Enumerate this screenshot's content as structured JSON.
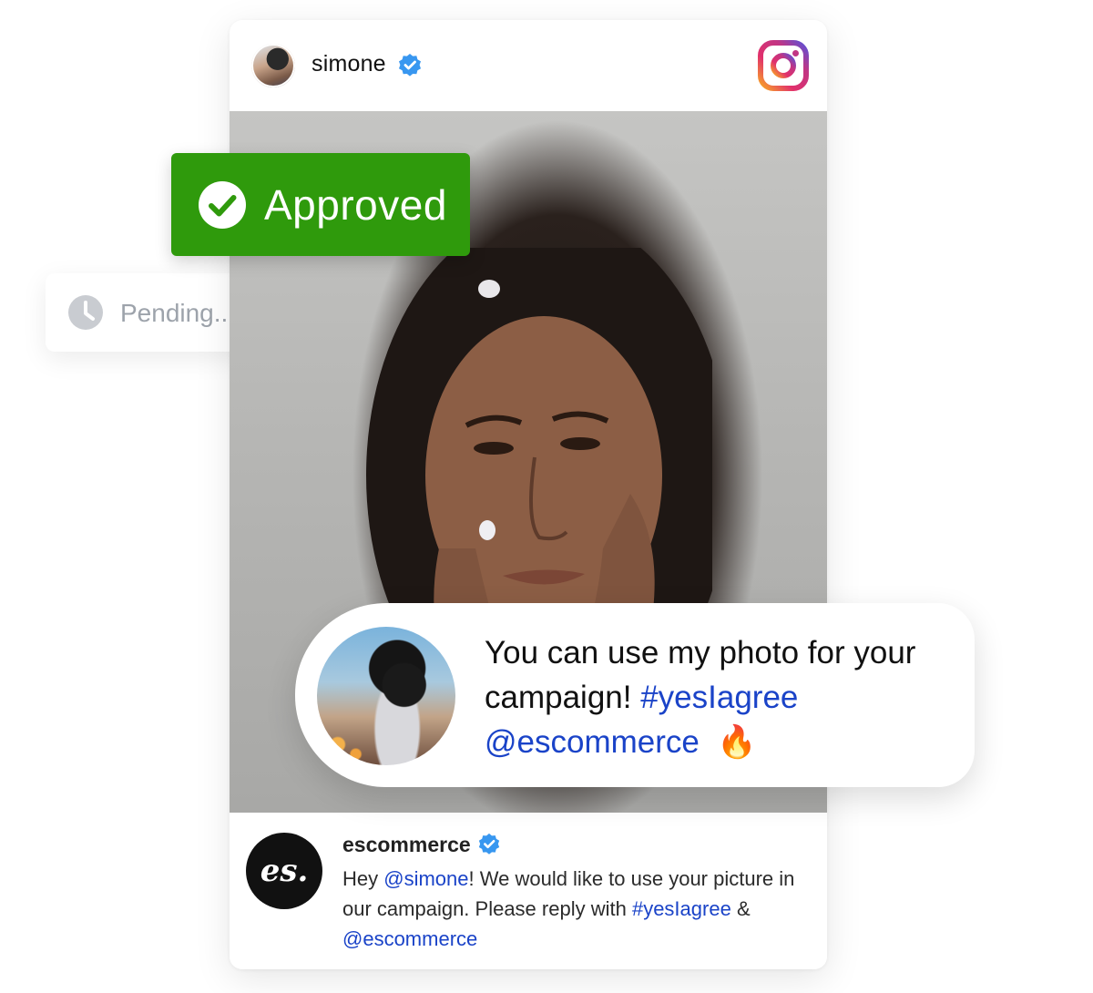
{
  "post": {
    "username": "simone",
    "platform_icon": "instagram-icon",
    "verified_icon": "verified-badge-icon"
  },
  "status": {
    "approved_label": "Approved",
    "pending_label": "Pending..",
    "approved_color": "#2f9a0c",
    "pending_color": "#9da3ab"
  },
  "reply_bubble": {
    "text_plain": "You can use my photo for your campaign!",
    "hashtag": "#yesIagree",
    "mention": "@escommerce",
    "emoji": "🔥"
  },
  "comment": {
    "username": "escommerce",
    "logo_text": "es.",
    "text_hey": "Hey",
    "mention_user": "@simone",
    "text_middle": "! We would like to use your picture in our campaign. Please reply with",
    "hashtag": "#yesIagree",
    "ampersand": "&",
    "mention_brand": "@escommerce"
  },
  "colors": {
    "link": "#1a43c8",
    "verified": "#3897f0"
  }
}
